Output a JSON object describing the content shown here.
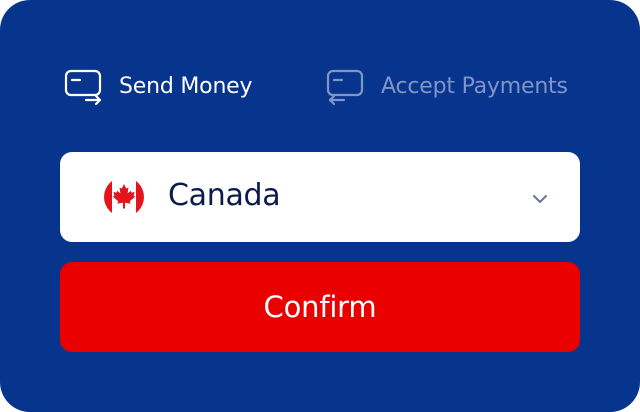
{
  "tabs": [
    {
      "label": "Send Money",
      "icon": "card-send-icon",
      "active": true
    },
    {
      "label": "Accept Payments",
      "icon": "card-receive-icon",
      "active": false
    }
  ],
  "country_select": {
    "value": "Canada",
    "flag": "canada-flag-icon"
  },
  "confirm_button": {
    "label": "Confirm"
  },
  "colors": {
    "background": "#07348c",
    "active_tab": "#ffffff",
    "inactive_tab": "#7f95c6",
    "confirm": "#eb0000",
    "select_bg": "#ffffff",
    "select_text": "#0d1b4c"
  }
}
